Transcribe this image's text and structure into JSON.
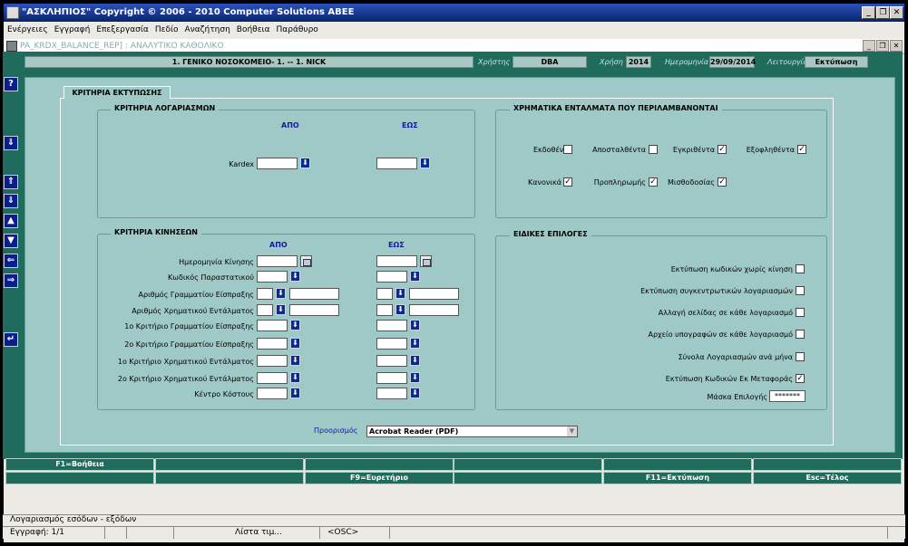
{
  "window": {
    "title": "\"ΑΣΚΛΗΠΙΟΣ\" Copyright © 2006 - 2010 Computer Solutions ΑΒΕΕ"
  },
  "menu": [
    "Ενέργειες",
    "Εγγραφή",
    "Επεξεργασία",
    "Πεδίο",
    "Αναζήτηση",
    "Βοήθεια",
    "Παράθυρο"
  ],
  "form_title": "PA_KRDX_BALANCE_REP]  :  ΑΝΑΛΥΤΙΚΟ ΚΑΘΟΛΙΚΟ",
  "info": {
    "organization": "1. ΓΕΝΙΚΟ ΝΟΣΟΚΟΜΕΙΟ- 1. -- 1. NICK",
    "user_label": "Χρήστης",
    "user": "DBA",
    "year_label": "Χρήση",
    "year": "2014",
    "date_label": "Ημερομηνία",
    "date": "29/09/2014",
    "function_label": "Λειτουργία",
    "function": "Εκτύπωση"
  },
  "tab": "ΚΡΙΤΗΡΙΑ ΕΚΤΥΠΩΣΗΣ",
  "accounts": {
    "title": "ΚΡΙΤΗΡΙΑ ΛΟΓΑΡΙΑΣΜΩΝ",
    "from": "ΑΠΟ",
    "to": "ΕΩΣ",
    "kardex": "Kardex"
  },
  "movements": {
    "title": "ΚΡΙΤΗΡΙΑ ΚΙΝΗΣΕΩΝ",
    "from": "ΑΠΟ",
    "to": "ΕΩΣ",
    "rows": [
      "Ημερομηνία Κίνησης",
      "Κωδικός Παραστατικού",
      "Αριθμός Γραμματίου Είσπραξης",
      "Αριθμός Χρηματικού Εντάλματος",
      "1ο Κριτήριο Γραμματίου Είσπραξης",
      "2ο Κριτήριο Γραμματίου Είσπραξης",
      "1ο Κριτήριο Χρηματικού Εντάλματος",
      "2ο Κριτήριο Χρηματικού Εντάλματος",
      "Κέντρο Κόστους"
    ]
  },
  "warrants": {
    "title": "ΧΡΗΜΑΤΙΚΑ ΕΝΤΑΛΜΑΤΑ ΠΟΥ ΠΕΡΙΛΑΜΒΑΝΟΝΤΑΙ",
    "items": [
      {
        "label": "Εκδοθέντα",
        "checked": false
      },
      {
        "label": "Αποσταλθέντα",
        "checked": false
      },
      {
        "label": "Εγκριθέντα",
        "checked": true
      },
      {
        "label": "Εξοφληθέντα",
        "checked": true
      },
      {
        "label": "Κανονικά",
        "checked": true
      },
      {
        "label": "Προπληρωμής",
        "checked": true
      },
      {
        "label": "Μισθοδοσίας",
        "checked": true
      }
    ]
  },
  "special": {
    "title": "ΕΙΔΙΚΕΣ ΕΠΙΛΟΓΕΣ",
    "options": [
      {
        "label": "Εκτύπωση κωδικών χωρίς κίνηση",
        "checked": false
      },
      {
        "label": "Εκτύπωση συγκεντρωτικών λογαριασμών",
        "checked": false
      },
      {
        "label": "Αλλαγή σελίδας σε κάθε λογαριασμό",
        "checked": false
      },
      {
        "label": "Αρχείο υπογραφών σε κάθε λογαριασμό",
        "checked": false
      },
      {
        "label": "Σύνολα Λογαριασμών ανά μήνα",
        "checked": false
      },
      {
        "label": "Εκτύπωση Κωδικών Εκ Μεταφοράς",
        "checked": true
      }
    ],
    "mask_label": "Μάσκα Επιλογής",
    "mask_value": "*******"
  },
  "destination": {
    "label": "Προορισμός",
    "value": "Acrobat Reader (PDF)"
  },
  "fkeys": {
    "row1": [
      "F1=Βοήθεια",
      "",
      "",
      "",
      "",
      ""
    ],
    "row2": [
      "",
      "",
      "F9=Ευρετήριο",
      "",
      "F11=Εκτύπωση",
      "Esc=Τέλος"
    ]
  },
  "status": {
    "line1": "Λογαριασμός εσόδων - εξόδων",
    "record": "Εγγραφή: 1/1",
    "list": "Λίστα τιμ...",
    "osc": "<OSC>"
  },
  "colors": {
    "canvas": "#1f6b5c",
    "panel": "#9ec9c6",
    "titlebar": "#0a246a",
    "lov_button": "#0c2b8c",
    "label_blue": "#1818a8"
  },
  "icons": {
    "lov": "arrow-down-icon",
    "calendar": "calendar-icon",
    "check": "check-icon"
  }
}
